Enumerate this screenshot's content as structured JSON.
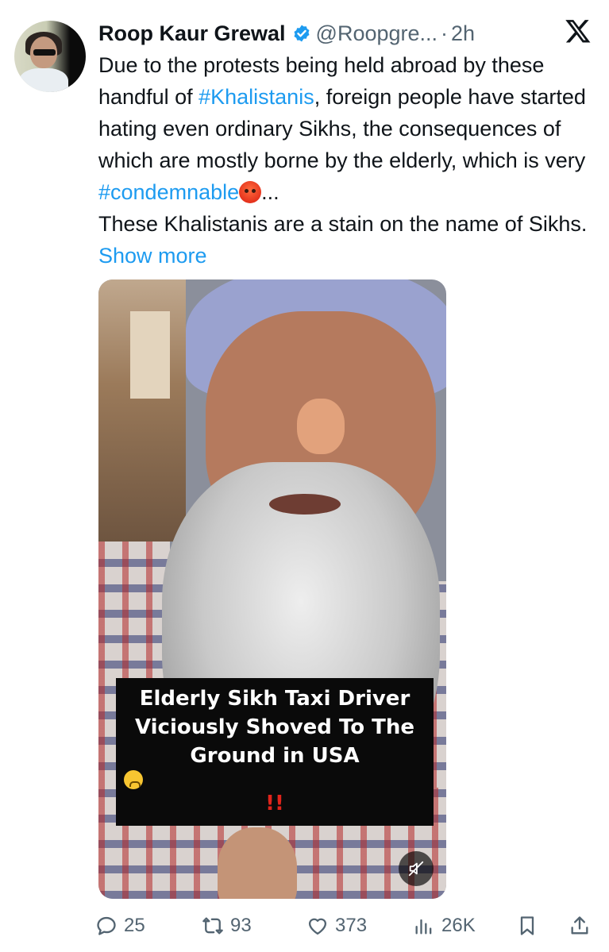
{
  "author": {
    "name": "Roop Kaur Grewal",
    "handle": "@Roopgre...",
    "separator": "·",
    "time": "2h",
    "verified": true
  },
  "tweet": {
    "text_1": "Due to the protests being held abroad by these handful of ",
    "hashtag_1": "#Khalistanis",
    "text_2": ", foreign people have started hating even ordinary Sikhs, the consequences of which are mostly borne by the elderly, which is very ",
    "hashtag_2": "#condemnable",
    "emoji": "angry-face",
    "ellipsis": "...",
    "text_3": "These Khalistanis are a stain on the name of Sikhs. ",
    "show_more": "Show more"
  },
  "media": {
    "caption_line_1": "Elderly Sikh Taxi Driver",
    "caption_line_2": "Viciously Shoved To The",
    "caption_line_3": "Ground in USA",
    "caption_emoji": "worried-face",
    "caption_bang": "!!",
    "muted": true
  },
  "actions": {
    "replies": "25",
    "reposts": "93",
    "likes": "373",
    "views": "26K"
  },
  "colors": {
    "link": "#1d9bf0",
    "secondary_text": "#536471",
    "verified": "#1d9bf0"
  },
  "icons": [
    "x-logo",
    "verified-badge-icon",
    "reply-icon",
    "repost-icon",
    "like-icon",
    "views-icon",
    "bookmark-icon",
    "share-icon",
    "mute-icon"
  ]
}
